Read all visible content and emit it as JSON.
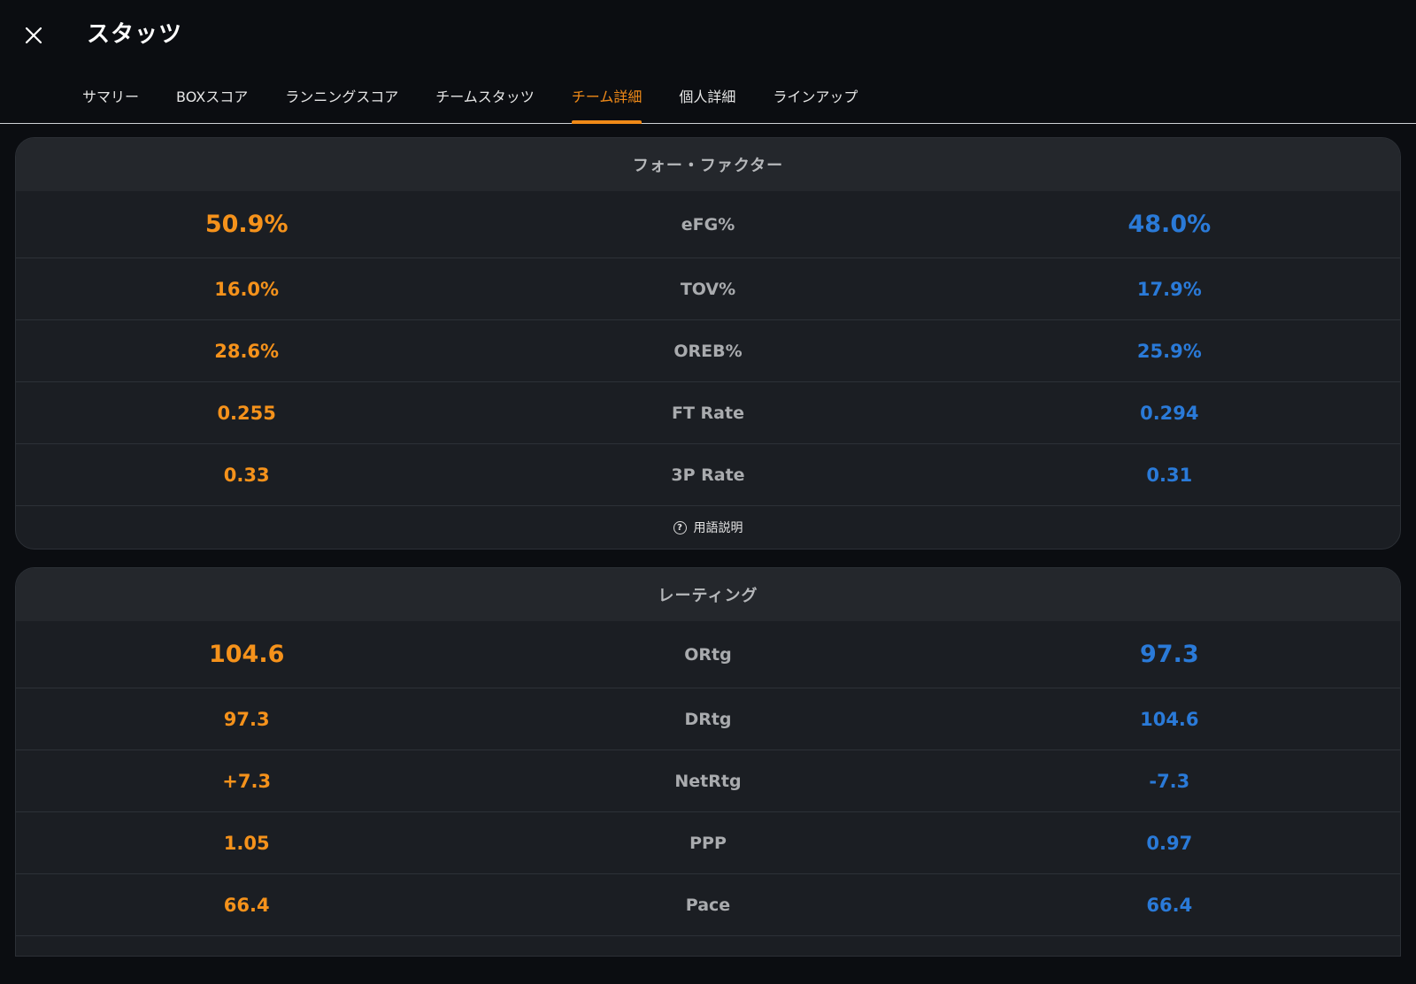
{
  "header": {
    "title": "スタッツ",
    "close_icon": "close-icon"
  },
  "tabs": [
    {
      "label": "サマリー",
      "active": false
    },
    {
      "label": "BOXスコア",
      "active": false
    },
    {
      "label": "ランニングスコア",
      "active": false
    },
    {
      "label": "チームスタッツ",
      "active": false
    },
    {
      "label": "チーム詳細",
      "active": true
    },
    {
      "label": "個人詳細",
      "active": false
    },
    {
      "label": "ラインアップ",
      "active": false
    }
  ],
  "colors": {
    "home": "#f5921b",
    "away": "#2a7ad8",
    "active_tab": "#f08a18"
  },
  "four_factors": {
    "title": "フォー・ファクター",
    "rows": [
      {
        "metric": "eFG%",
        "home": "50.9%",
        "away": "48.0%"
      },
      {
        "metric": "TOV%",
        "home": "16.0%",
        "away": "17.9%"
      },
      {
        "metric": "OREB%",
        "home": "28.6%",
        "away": "25.9%"
      },
      {
        "metric": "FT Rate",
        "home": "0.255",
        "away": "0.294"
      },
      {
        "metric": "3P Rate",
        "home": "0.33",
        "away": "0.31"
      }
    ],
    "glossary_label": "用語説明",
    "glossary_icon": "help-circle-icon"
  },
  "ratings": {
    "title": "レーティング",
    "rows": [
      {
        "metric": "ORtg",
        "home": "104.6",
        "away": "97.3"
      },
      {
        "metric": "DRtg",
        "home": "97.3",
        "away": "104.6"
      },
      {
        "metric": "NetRtg",
        "home": "+7.3",
        "away": "-7.3"
      },
      {
        "metric": "PPP",
        "home": "1.05",
        "away": "0.97"
      },
      {
        "metric": "Pace",
        "home": "66.4",
        "away": "66.4"
      }
    ]
  }
}
